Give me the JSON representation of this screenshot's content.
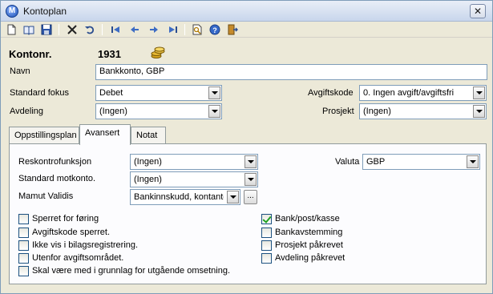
{
  "window": {
    "title": "Kontoplan",
    "app_icon_letter": "M"
  },
  "header": {
    "kontonr_label": "Kontonr.",
    "kontonr_value": "1931",
    "navn_label": "Navn",
    "navn_value": "Bankkonto, GBP"
  },
  "form": {
    "standard_fokus_label": "Standard fokus",
    "standard_fokus_value": "Debet",
    "avdeling_label": "Avdeling",
    "avdeling_value": "(Ingen)",
    "avgiftskode_label": "Avgiftskode",
    "avgiftskode_value": "0. Ingen avgift/avgiftsfri",
    "prosjekt_label": "Prosjekt",
    "prosjekt_value": "(Ingen)"
  },
  "tabs": [
    {
      "label": "Oppstillingsplan"
    },
    {
      "label": "Avansert"
    },
    {
      "label": "Notat"
    }
  ],
  "advanced": {
    "reskontrofunksjon_label": "Reskontrofunksjon",
    "reskontrofunksjon_value": "(Ingen)",
    "standard_motkonto_label": "Standard motkonto.",
    "standard_motkonto_value": "(Ingen)",
    "mamut_validis_label": "Mamut Validis",
    "mamut_validis_value": "Bankinnskudd, kontanter",
    "ellipsis_label": "...",
    "valuta_label": "Valuta",
    "valuta_value": "GBP"
  },
  "checkboxes_left": [
    {
      "label": "Sperret for føring",
      "checked": false
    },
    {
      "label": "Avgiftskode sperret.",
      "checked": false
    },
    {
      "label": "Ikke vis i bilagsregistrering.",
      "checked": false
    },
    {
      "label": "Utenfor avgiftsområdet.",
      "checked": false
    },
    {
      "label": "Skal være med i grunnlag for utgående omsetning.",
      "checked": false
    }
  ],
  "checkboxes_right": [
    {
      "label": "Bank/post/kasse",
      "checked": true
    },
    {
      "label": "Bankavstemming",
      "checked": false
    },
    {
      "label": "Prosjekt påkrevet",
      "checked": false
    },
    {
      "label": "Avdeling påkrevet",
      "checked": false
    }
  ],
  "toolbar": {
    "buttons": [
      "new-icon",
      "open-book-icon",
      "save-icon",
      "delete-icon",
      "undo-icon",
      "first-record-icon",
      "previous-record-icon",
      "next-record-icon",
      "last-record-icon",
      "print-preview-icon",
      "help-icon",
      "exit-icon"
    ]
  },
  "colors": {
    "title_bar": "#c8d6ec",
    "window_bg": "#ece9d8",
    "field_border": "#7f9db9",
    "check_green": "#21a121"
  }
}
